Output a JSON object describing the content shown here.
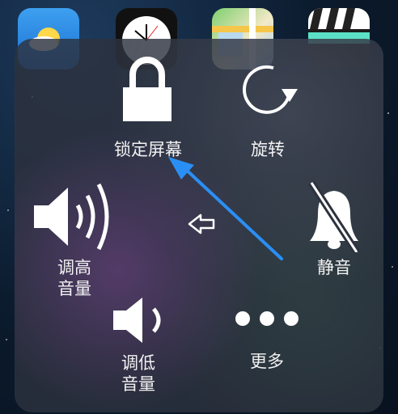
{
  "home_icons": [
    {
      "name": "weather"
    },
    {
      "name": "clock"
    },
    {
      "name": "maps"
    },
    {
      "name": "videos"
    }
  ],
  "assistive_menu": {
    "lock_screen": {
      "label": "锁定屏幕",
      "icon": "lock-icon"
    },
    "rotate": {
      "label": "旋转",
      "icon": "rotate-icon"
    },
    "volume_up": {
      "label_line1": "调高",
      "label_line2": "音量",
      "icon": "speaker-loud-icon"
    },
    "back": {
      "icon": "back-arrow-icon"
    },
    "mute": {
      "label": "静音",
      "icon": "bell-muted-icon"
    },
    "volume_down": {
      "label_line1": "调低",
      "label_line2": "音量",
      "icon": "speaker-soft-icon"
    },
    "more": {
      "label": "更多",
      "icon": "more-dots-icon"
    }
  },
  "annotation": {
    "arrow_color": "#2a8ff5"
  }
}
